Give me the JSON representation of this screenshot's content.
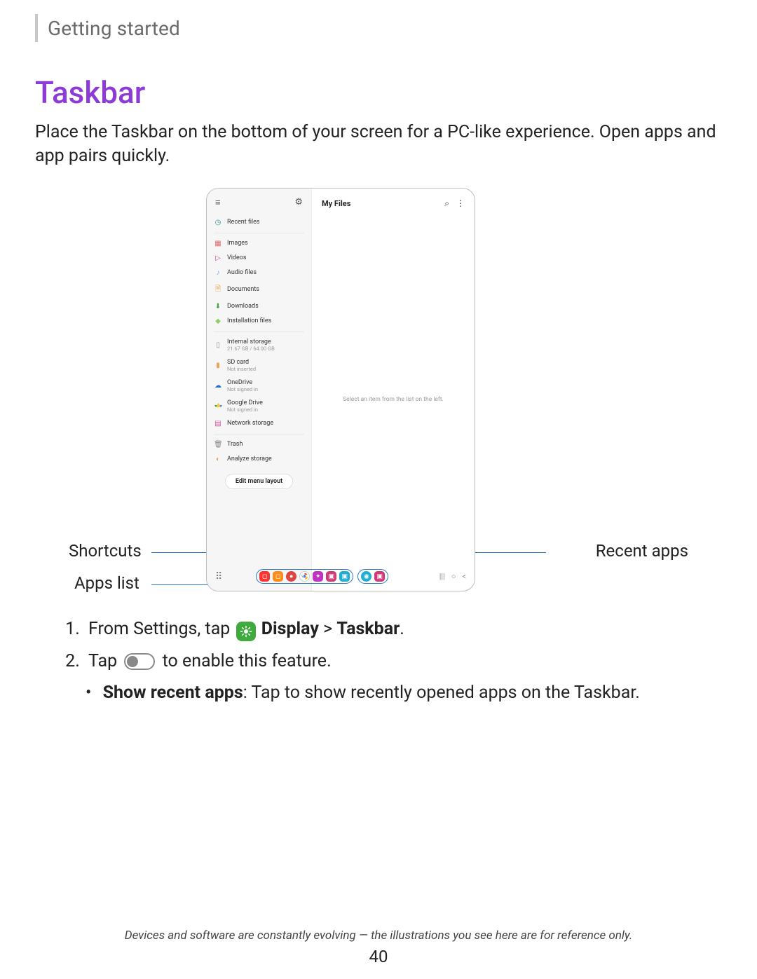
{
  "breadcrumb": "Getting started",
  "title": "Taskbar",
  "lead": "Place the Taskbar on the bottom of your screen for a PC-like experience. Open apps and app pairs quickly.",
  "figure": {
    "my_files_title": "My Files",
    "placeholder": "Select an item from the list on the left.",
    "sidebar": {
      "recent_files": "Recent files",
      "images": "Images",
      "videos": "Videos",
      "audio": "Audio files",
      "documents": "Documents",
      "downloads": "Downloads",
      "installation": "Installation files",
      "internal_storage": "Internal storage",
      "internal_storage_sub": "21.67 GB / 64.00 GB",
      "sd_card": "SD card",
      "sd_card_sub": "Not inserted",
      "onedrive": "OneDrive",
      "onedrive_sub": "Not signed in",
      "gdrive": "Google Drive",
      "gdrive_sub": "Not signed in",
      "network": "Network storage",
      "trash": "Trash",
      "analyze": "Analyze storage",
      "edit_menu": "Edit menu layout"
    },
    "callouts": {
      "shortcuts": "Shortcuts",
      "apps_list": "Apps list",
      "recent_apps": "Recent apps"
    }
  },
  "steps": {
    "s1_pre": "From Settings, tap",
    "s1_display": "Display",
    "s1_sep": ">",
    "s1_taskbar": "Taskbar",
    "s2_pre": "Tap",
    "s2_post": "to enable this feature.",
    "bullet_title": "Show recent apps",
    "bullet_rest": ": Tap to show recently opened apps on the Taskbar."
  },
  "footnote": "Devices and software are constantly evolving — the illustrations you see here are for reference only.",
  "page_number": "40"
}
